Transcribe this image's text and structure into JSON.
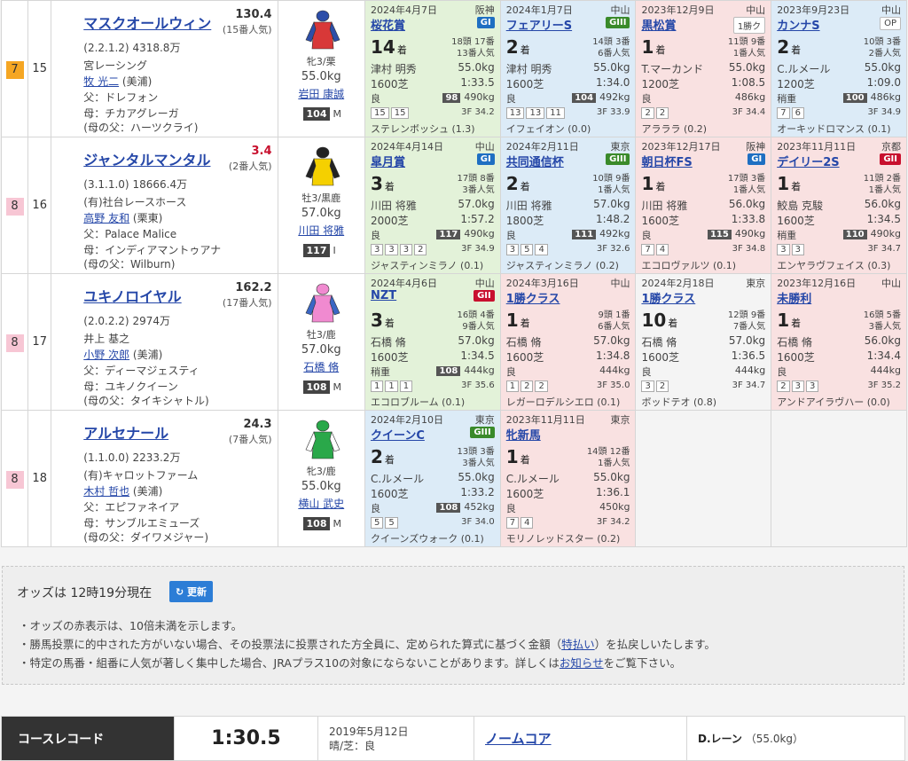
{
  "horses": [
    {
      "waku": "7",
      "waku_color": "#f5a623",
      "num": "15",
      "name": "マスクオールウィン",
      "odds": "130.4",
      "odds_red": false,
      "pop": "(15番人気)",
      "record": "(2.2.1.2)",
      "money": "4318.8万",
      "owner": "宮レーシング",
      "trainer": "牧 光二",
      "stable": "(美浦)",
      "sire": "父：ドレフォン",
      "dam": "母：チカアグレーガ",
      "damsire": "(母の父：ハーツクライ)",
      "sex": "牝3/栗",
      "weight": "55.0kg",
      "jockey": "岩田 康誠",
      "rating": "104",
      "rating_mark": "M",
      "silk_body": "#d83838",
      "silk_sleeve": "#2d4ea8",
      "silk_cap": "#2d4ea8",
      "past": [
        {
          "bg": "green",
          "date": "2024年4月7日",
          "place": "阪神",
          "race": "桜花賞",
          "grade": "GI",
          "gclass": "g1",
          "rank": "14",
          "heads": [
            "18頭 17番",
            "13番人気"
          ],
          "jock": "津村 明秀",
          "jwt": "55.0kg",
          "dist": "1600芝",
          "time": "1:33.5",
          "cond": "良",
          "bwn": "98",
          "bw": "490kg",
          "pos": [
            "15",
            "15"
          ],
          "f3": "3F 34.2",
          "winner": "ステレンボッシュ (1.3)"
        },
        {
          "bg": "blue",
          "date": "2024年1月7日",
          "place": "中山",
          "race": "フェアリーS",
          "grade": "GIII",
          "gclass": "g3",
          "rank": "2",
          "heads": [
            "14頭 3番",
            "6番人気"
          ],
          "jock": "津村 明秀",
          "jwt": "55.0kg",
          "dist": "1600芝",
          "time": "1:34.0",
          "cond": "良",
          "bwn": "104",
          "bw": "492kg",
          "pos": [
            "13",
            "13",
            "11"
          ],
          "f3": "3F 33.9",
          "winner": "イフェイオン (0.0)"
        },
        {
          "bg": "pink",
          "date": "2023年12月9日",
          "place": "中山",
          "race": "黒松賞",
          "grade": "1勝ク",
          "gclass": "other",
          "rank": "1",
          "heads": [
            "11頭 9番",
            "1番人気"
          ],
          "jock": "T.マーカンド",
          "jwt": "55.0kg",
          "dist": "1200芝",
          "time": "1:08.5",
          "cond": "良",
          "bwn": "",
          "bw": "486kg",
          "pos": [
            "2",
            "2"
          ],
          "f3": "3F 34.4",
          "winner": "アラララ (0.2)"
        },
        {
          "bg": "blue",
          "date": "2023年9月23日",
          "place": "中山",
          "race": "カンナS",
          "grade": "OP",
          "gclass": "other",
          "rank": "2",
          "heads": [
            "10頭 3番",
            "2番人気"
          ],
          "jock": "C.ルメール",
          "jwt": "55.0kg",
          "dist": "1200芝",
          "time": "1:09.0",
          "cond": "稍重",
          "bwn": "100",
          "bw": "486kg",
          "pos": [
            "7",
            "6"
          ],
          "f3": "3F 34.9",
          "winner": "オーキッドロマンス (0.1)"
        }
      ]
    },
    {
      "waku": "8",
      "waku_color": "#f7c6d4",
      "num": "16",
      "name": "ジャンタルマンタル",
      "odds": "3.4",
      "odds_red": true,
      "pop": "(2番人気)",
      "record": "(3.1.1.0)",
      "money": "18666.4万",
      "owner": "(有)社台レースホース",
      "trainer": "高野 友和",
      "stable": "(栗東)",
      "sire": "父：Palace Malice",
      "dam": "母：インディアマントゥアナ",
      "damsire": "(母の父：Wilburn)",
      "sex": "牡3/黒鹿",
      "weight": "57.0kg",
      "jockey": "川田 将雅",
      "rating": "117",
      "rating_mark": "I",
      "silk_body": "#f5d000",
      "silk_sleeve": "#222",
      "silk_cap": "#222",
      "past": [
        {
          "bg": "green",
          "date": "2024年4月14日",
          "place": "中山",
          "race": "皐月賞",
          "grade": "GI",
          "gclass": "g1",
          "rank": "3",
          "heads": [
            "17頭 8番",
            "3番人気"
          ],
          "jock": "川田 将雅",
          "jwt": "57.0kg",
          "dist": "2000芝",
          "time": "1:57.2",
          "cond": "良",
          "bwn": "117",
          "bw": "490kg",
          "pos": [
            "3",
            "3",
            "3",
            "2"
          ],
          "f3": "3F 34.9",
          "winner": "ジャスティンミラノ (0.1)"
        },
        {
          "bg": "blue",
          "date": "2024年2月11日",
          "place": "東京",
          "race": "共同通信杯",
          "grade": "GIII",
          "gclass": "g3",
          "rank": "2",
          "heads": [
            "10頭 9番",
            "1番人気"
          ],
          "jock": "川田 将雅",
          "jwt": "57.0kg",
          "dist": "1800芝",
          "time": "1:48.2",
          "cond": "良",
          "bwn": "111",
          "bw": "492kg",
          "pos": [
            "3",
            "5",
            "4"
          ],
          "f3": "3F 32.6",
          "winner": "ジャスティンミラノ (0.2)"
        },
        {
          "bg": "pink",
          "date": "2023年12月17日",
          "place": "阪神",
          "race": "朝日杯FS",
          "grade": "GI",
          "gclass": "g1",
          "rank": "1",
          "heads": [
            "17頭 3番",
            "1番人気"
          ],
          "jock": "川田 将雅",
          "jwt": "56.0kg",
          "dist": "1600芝",
          "time": "1:33.8",
          "cond": "良",
          "bwn": "115",
          "bw": "490kg",
          "pos": [
            "7",
            "4"
          ],
          "f3": "3F 34.8",
          "winner": "エコロヴァルツ (0.1)"
        },
        {
          "bg": "pink",
          "date": "2023年11月11日",
          "place": "京都",
          "race": "デイリー2S",
          "grade": "GII",
          "gclass": "g2",
          "rank": "1",
          "heads": [
            "11頭 2番",
            "1番人気"
          ],
          "jock": "鮫島 克駿",
          "jwt": "56.0kg",
          "dist": "1600芝",
          "time": "1:34.5",
          "cond": "稍重",
          "bwn": "110",
          "bw": "490kg",
          "pos": [
            "3",
            "3"
          ],
          "f3": "3F 34.7",
          "winner": "エンヤラヴフェイス (0.3)"
        }
      ]
    },
    {
      "waku": "8",
      "waku_color": "#f7c6d4",
      "num": "17",
      "name": "ユキノロイヤル",
      "odds": "162.2",
      "odds_red": false,
      "pop": "(17番人気)",
      "record": "(2.0.2.2)",
      "money": "2974万",
      "owner": "井上 基之",
      "trainer": "小野 次郎",
      "stable": "(美浦)",
      "sire": "父：ディーマジェスティ",
      "dam": "母：ユキノクイーン",
      "damsire": "(母の父：タイキシャトル)",
      "sex": "牡3/鹿",
      "weight": "57.0kg",
      "jockey": "石橋 脩",
      "rating": "108",
      "rating_mark": "M",
      "silk_body": "#f08ad0",
      "silk_sleeve": "#3a66c4",
      "silk_cap": "#f08ad0",
      "past": [
        {
          "bg": "green",
          "date": "2024年4月6日",
          "place": "中山",
          "race": "NZT",
          "grade": "GII",
          "gclass": "g2",
          "rank": "3",
          "heads": [
            "16頭 4番",
            "9番人気"
          ],
          "jock": "石橋 脩",
          "jwt": "57.0kg",
          "dist": "1600芝",
          "time": "1:34.5",
          "cond": "稍重",
          "bwn": "108",
          "bw": "444kg",
          "pos": [
            "1",
            "1",
            "1"
          ],
          "f3": "3F 35.6",
          "winner": "エコロブルーム (0.1)"
        },
        {
          "bg": "pink",
          "date": "2024年3月16日",
          "place": "中山",
          "race": "1勝クラス",
          "grade": "",
          "gclass": "",
          "rank": "1",
          "heads": [
            "9頭 1番",
            "6番人気"
          ],
          "jock": "石橋 脩",
          "jwt": "57.0kg",
          "dist": "1600芝",
          "time": "1:34.8",
          "cond": "良",
          "bwn": "",
          "bw": "444kg",
          "pos": [
            "1",
            "2",
            "2"
          ],
          "f3": "3F 35.0",
          "winner": "レガーロデルシエロ (0.1)"
        },
        {
          "bg": "gray",
          "date": "2024年2月18日",
          "place": "東京",
          "race": "1勝クラス",
          "grade": "",
          "gclass": "",
          "rank": "10",
          "heads": [
            "12頭 9番",
            "7番人気"
          ],
          "jock": "石橋 脩",
          "jwt": "57.0kg",
          "dist": "1600芝",
          "time": "1:36.5",
          "cond": "良",
          "bwn": "",
          "bw": "444kg",
          "pos": [
            "3",
            "2"
          ],
          "f3": "3F 34.7",
          "winner": "ボッドテオ (0.8)"
        },
        {
          "bg": "pink",
          "date": "2023年12月16日",
          "place": "中山",
          "race": "未勝利",
          "grade": "",
          "gclass": "",
          "rank": "1",
          "heads": [
            "16頭 5番",
            "3番人気"
          ],
          "jock": "石橋 脩",
          "jwt": "56.0kg",
          "dist": "1600芝",
          "time": "1:34.4",
          "cond": "良",
          "bwn": "",
          "bw": "444kg",
          "pos": [
            "2",
            "3",
            "3"
          ],
          "f3": "3F 35.2",
          "winner": "アンドアイラヴハー (0.0)"
        }
      ]
    },
    {
      "waku": "8",
      "waku_color": "#f7c6d4",
      "num": "18",
      "name": "アルセナール",
      "odds": "24.3",
      "odds_red": false,
      "pop": "(7番人気)",
      "record": "(1.1.0.0)",
      "money": "2233.2万",
      "owner": "(有)キャロットファーム",
      "trainer": "木村 哲也",
      "stable": "(美浦)",
      "sire": "父：エピファネイア",
      "dam": "母：サンブルエミューズ",
      "damsire": "(母の父：ダイワメジャー)",
      "sex": "牝3/鹿",
      "weight": "55.0kg",
      "jockey": "横山 武史",
      "rating": "108",
      "rating_mark": "M",
      "silk_body": "#2aa84a",
      "silk_sleeve": "#ffffff",
      "silk_cap": "#2aa84a",
      "past": [
        {
          "bg": "blue",
          "date": "2024年2月10日",
          "place": "東京",
          "race": "クイーンC",
          "grade": "GIII",
          "gclass": "g3",
          "rank": "2",
          "heads": [
            "13頭 3番",
            "3番人気"
          ],
          "jock": "C.ルメール",
          "jwt": "55.0kg",
          "dist": "1600芝",
          "time": "1:33.2",
          "cond": "良",
          "bwn": "108",
          "bw": "452kg",
          "pos": [
            "5",
            "5"
          ],
          "f3": "3F 34.0",
          "winner": "クイーンズウォーク (0.1)"
        },
        {
          "bg": "pink",
          "date": "2023年11月11日",
          "place": "東京",
          "race": "牝新馬",
          "grade": "",
          "gclass": "",
          "rank": "1",
          "heads": [
            "14頭 12番",
            "1番人気"
          ],
          "jock": "C.ルメール",
          "jwt": "55.0kg",
          "dist": "1600芝",
          "time": "1:36.1",
          "cond": "良",
          "bwn": "",
          "bw": "450kg",
          "pos": [
            "7",
            "4"
          ],
          "f3": "3F 34.2",
          "winner": "モリノレッドスター (0.2)"
        },
        null,
        null
      ]
    }
  ],
  "odds_notice": {
    "lead": "オッズは 12時19分現在",
    "update_label": "↻ 更新",
    "note1": "・オッズの赤表示は、10倍未満を示します。",
    "note2_pre": "・勝馬投票に的中された方がいない場合、その投票法に投票された方全員に、定められた算式に基づく金額（",
    "note2_link": "特払い",
    "note2_post": "）を払戻しいたします。",
    "note3_pre": "・特定の馬番・組番に人気が著しく集中した場合、JRAプラス10の対象にならないことがあります。詳しくは",
    "note3_link": "お知らせ",
    "note3_post": "をご覧下さい。"
  },
  "course_record": {
    "label": "コースレコード",
    "time": "1:30.5",
    "date": "2019年5月12日",
    "weather": "晴/芝：良",
    "horse": "ノームコア",
    "jockey": "D.レーン",
    "weight": "（55.0kg）"
  },
  "colors": {
    "link": "#2547a8",
    "odds_red": "#c8102e",
    "g1": "#1f6fc2",
    "g2": "#c8102e",
    "g3": "#3a8a2a"
  }
}
